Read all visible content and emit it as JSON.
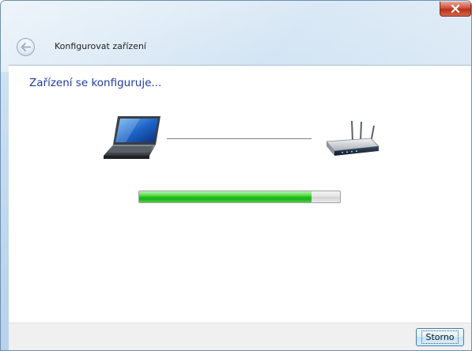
{
  "window": {
    "title": "Konfigurovat zařízení",
    "close_icon": "close-icon"
  },
  "main": {
    "heading": "Zařízení se konfiguruje...",
    "source_icon": "laptop-icon",
    "target_icon": "wireless-router-icon",
    "progress_percent": 86
  },
  "footer": {
    "cancel_label": "Storno"
  },
  "colors": {
    "heading": "#1f3c9c",
    "progress_fill": "#22c21a",
    "close_button": "#c8452c"
  }
}
